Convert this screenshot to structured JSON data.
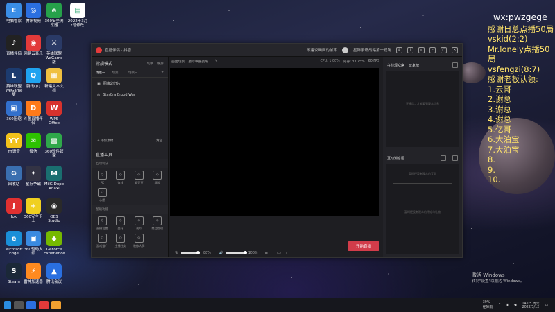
{
  "desktop": {
    "icons": [
      {
        "label": "电脑管家",
        "color": "#3a8ee6",
        "glyph": "E"
      },
      {
        "label": "腾讯视频",
        "color": "#2b6fe0",
        "glyph": "◎"
      },
      {
        "label": "360安全浏览器",
        "color": "#26a14a",
        "glyph": "e"
      },
      {
        "label": "2022年3月12号修改...",
        "color": "#ffffff",
        "glyph": "▤"
      },
      {
        "label": "直播伴侣",
        "color": "#222222",
        "glyph": "♪"
      },
      {
        "label": "网易云音乐",
        "color": "#e23a3a",
        "glyph": "◉"
      },
      {
        "label": "英雄联盟WeGame版",
        "color": "#2a3a66",
        "glyph": "⚔"
      },
      {
        "label": "英雄联盟WeGame版",
        "color": "#1c3b6f",
        "glyph": "L"
      },
      {
        "label": "腾讯QQ",
        "color": "#1fa3f0",
        "glyph": "Q"
      },
      {
        "label": "新建文本文档",
        "color": "#f0c040",
        "glyph": "▦"
      },
      {
        "label": "360压缩",
        "color": "#3270cc",
        "glyph": "▣"
      },
      {
        "label": "斗鱼直播伴侣",
        "color": "#ff7a1a",
        "glyph": "D"
      },
      {
        "label": "WPS Office",
        "color": "#d8322d",
        "glyph": "W"
      },
      {
        "label": "YY语音",
        "color": "#f2c21b",
        "glyph": "YY"
      },
      {
        "label": "微信",
        "color": "#2dc100",
        "glyph": "✉"
      },
      {
        "label": "360软件管家",
        "color": "#2fa84a",
        "glyph": "▩"
      },
      {
        "label": "回收站",
        "color": "#3a6fb0",
        "glyph": "♻"
      },
      {
        "label": "星际争霸",
        "color": "#333344",
        "glyph": "✦"
      },
      {
        "label": "MilG Dope Anaxi",
        "color": "#1a6f70",
        "glyph": "M"
      },
      {
        "label": "Jok",
        "color": "#e03030",
        "glyph": "J"
      },
      {
        "label": "360安全卫士",
        "color": "#f0d020",
        "glyph": "+"
      },
      {
        "label": "OBS Studio",
        "color": "#2a2a2a",
        "glyph": "◉"
      },
      {
        "label": "Microsoft Edge",
        "color": "#1a8fd8",
        "glyph": "e"
      },
      {
        "label": "360驱动大师",
        "color": "#3a8ae0",
        "glyph": "▣"
      },
      {
        "label": "GeForce Experience",
        "color": "#76b900",
        "glyph": "◆"
      },
      {
        "label": "Steam",
        "color": "#1b2838",
        "glyph": "S"
      },
      {
        "label": "雷神加速器",
        "color": "#ff8a20",
        "glyph": "⚡"
      },
      {
        "label": "腾讯会议",
        "color": "#2a6fe0",
        "glyph": "▲"
      }
    ]
  },
  "overlay": {
    "wx": "wx:pwzgege",
    "lines": [
      "感谢日总点播50局",
      "vskid(2:2)",
      "Mr.lonely点播50局",
      "vsfengzi(8:7)",
      "感谢老板认领:",
      "1.云哥",
      "2.谢总",
      "3.谢总",
      "4.谢总",
      "5.亿哥",
      "6.大泊宝",
      "7.大泊宝",
      "8.",
      "9.",
      "10."
    ]
  },
  "window": {
    "title": "直播伴侣 · 抖音",
    "notice": "不建议画面的帧率",
    "game": "星际争霸战略第一视角",
    "left": {
      "mode_title": "常规模式",
      "mode_switch": "切换",
      "mode_extra": "横屏",
      "scene_tabs": [
        "场景一",
        "场景二",
        "场景三"
      ],
      "sources": [
        "图像幻灯片",
        "StarCra Brood War"
      ],
      "add_source": "+ 添加素材",
      "add_source_right": "清空",
      "tools_title": "直播工具",
      "group1": "互动玩法",
      "tools1": [
        "PK",
        "连线",
        "聊天室",
        "福袋",
        "心愿"
      ],
      "group2": "基础功能",
      "tools2": [
        "直播设置",
        "美化",
        "观众",
        "商品管理",
        "游戏推广",
        "主播任务",
        "装修大屏"
      ]
    },
    "center": {
      "tab1": "画面场景",
      "tab2": "星际争霸战略...",
      "cpu": "CPU: 1.00%",
      "mem": "内存: 33.75%",
      "fps": "60 FPS",
      "mic_volume": "88%",
      "speaker_volume": "100%",
      "go_live": "开始直播",
      "mic_level": 0.88,
      "speaker_level": 1.0
    },
    "right": {
      "tab1": "在线观众席",
      "tab2": "玩家榜",
      "viewers_empty": "开播后，才能看到观众信息",
      "msg_title": "互动消息区",
      "msg_empty1": "暂时还没有观众的互动",
      "msg_empty2": "暂时还没有观众的评论与礼物"
    }
  },
  "taskbar": {
    "weather": "39%",
    "weather_sub": "在降雨",
    "time": "14:05 周六",
    "date": "2022/3/12"
  },
  "activate": {
    "line1": "激活 Windows",
    "line2": "转到\"设置\"以激活 Windows。"
  }
}
